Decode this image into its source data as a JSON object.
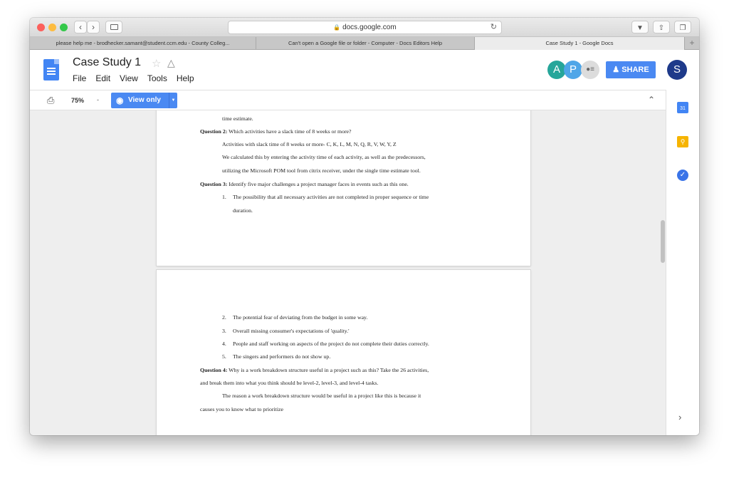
{
  "browser": {
    "url": "docs.google.com",
    "tabs": [
      {
        "label": "please help me - brodhecker.samant@student.ccm.edu - County Colleg..."
      },
      {
        "label": "Can't open a Google file or folder - Computer - Docs Editors Help"
      },
      {
        "label": "Case Study 1 - Google Docs"
      }
    ],
    "new_tab_label": "+"
  },
  "docs": {
    "title": "Case Study 1",
    "menu": [
      "File",
      "Edit",
      "View",
      "Tools",
      "Help"
    ],
    "avatars": [
      "A",
      "P",
      "S"
    ],
    "share_label": "SHARE",
    "zoom": "75%",
    "zoom_dropdown": "-",
    "view_only_label": "View only"
  },
  "side_panel": {
    "calendar_label": "31"
  },
  "document": {
    "page1": [
      "time estimate.",
      "Question 2:",
      " Which activities have a slack time of 8 weeks or more?",
      "Activities with slack time of 8 weeks or more- C, K, L, M, N, Q, R, V, W, Y, Z",
      "We calculated this by entering the activity time of each activity, as well as the predecessors,",
      "utilizing the Microsoft POM tool from citrix receiver, under the single time estimate tool.",
      "Question 3:",
      " Identify five major challenges a project manager faces in events such as this one.",
      "1.",
      "The possibility that all necessary activities are not completed in proper sequence or time",
      "duration."
    ],
    "page2": [
      "2.",
      "The potential fear of deviating from the budget in some way.",
      "3.",
      "Overall missing consumer's expectations of 'quality.'",
      "4.",
      "People and staff working on aspects of the project do not complete their duties correctly.",
      "5.",
      "The singers and performers do not show up.",
      "Question 4:",
      " Why is a work breakdown structure useful in a project such as this? Take the 26 activities,",
      "and break them into what you think should be level-2, level-3, and level-4 tasks.",
      "The reason a work breakdown structure would be useful in a project like this is because it",
      "causes you to know what to prioritize"
    ]
  },
  "colors": {
    "accent": "#4a89f2",
    "avatar_a": "#26a69a",
    "avatar_p": "#4fa6e8",
    "avatar_s": "#1e3a8a"
  }
}
